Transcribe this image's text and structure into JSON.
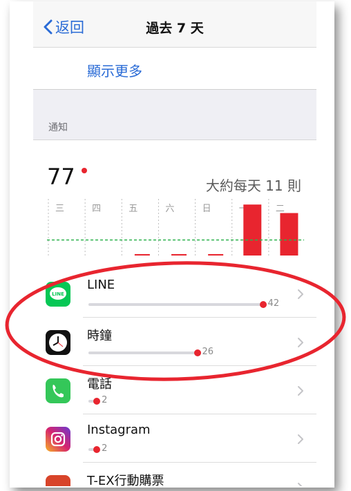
{
  "nav": {
    "back_label": "返回",
    "title": "過去 7 天"
  },
  "show_more": "顯示更多",
  "section_label": "通知",
  "summary": {
    "total": "77",
    "average_text": "大約每天 11 則"
  },
  "chart_data": {
    "type": "bar",
    "categories": [
      "三",
      "四",
      "五",
      "六",
      "日",
      "一",
      "二"
    ],
    "values": [
      0,
      0,
      1,
      1,
      1,
      36,
      30
    ],
    "average": 11,
    "average_line_color": "#2bb24c",
    "bar_color": "#e8252f",
    "title": "",
    "xlabel": "",
    "ylabel": ""
  },
  "apps": [
    {
      "name": "LINE",
      "count": "42",
      "fraction": 0.45,
      "icon": "line-icon",
      "color": "#06c755"
    },
    {
      "name": "時鐘",
      "count": "26",
      "fraction": 0.28,
      "icon": "clock-icon",
      "color": "#111111"
    },
    {
      "name": "電話",
      "count": "2",
      "fraction": 0.02,
      "icon": "phone-icon",
      "color": "#34c759"
    },
    {
      "name": "Instagram",
      "count": "2",
      "fraction": 0.02,
      "icon": "instagram-icon",
      "color": "#c13584"
    },
    {
      "name": "T-EX行動購票",
      "count": "",
      "fraction": 0.0,
      "icon": "t-ex-icon",
      "color": "#d8442a"
    }
  ],
  "accent": "#2a6bd6",
  "annotation_color": "#e8252f"
}
